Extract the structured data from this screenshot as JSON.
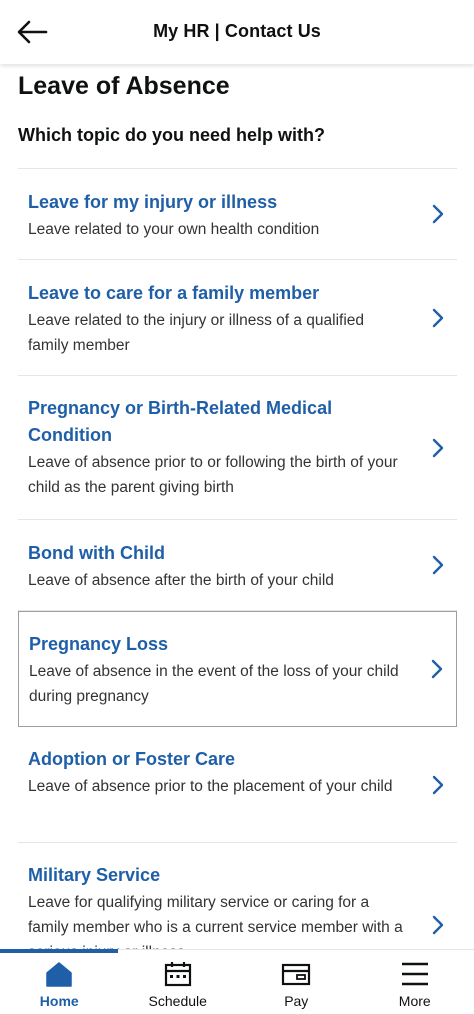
{
  "header": {
    "title": "My HR | Contact Us"
  },
  "page": {
    "title": "Leave of Absence",
    "question": "Which topic do you need help with?"
  },
  "topics": [
    {
      "title": "Leave for my injury or illness",
      "description": "Leave related to your own health condition"
    },
    {
      "title": "Leave to care for a family member",
      "description": "Leave related to the injury or illness of a qualified family member"
    },
    {
      "title": "Pregnancy or Birth-Related Medical Condition",
      "description": "Leave of absence prior to or following the birth of your child as the parent giving birth"
    },
    {
      "title": "Bond with Child",
      "description": "Leave of absence after the birth of your child"
    },
    {
      "title": "Pregnancy Loss",
      "description": "Leave of absence in the event of the loss of your child during pregnancy"
    },
    {
      "title": "Adoption or Foster Care",
      "description": "Leave of absence prior to the placement of your child"
    },
    {
      "title": "Military Service",
      "description": "Leave for qualifying military service or caring for a family member who is a current service member with a serious injury or illness"
    }
  ],
  "nav": {
    "items": [
      {
        "label": "Home",
        "icon": "home-icon",
        "active": true
      },
      {
        "label": "Schedule",
        "icon": "calendar-icon",
        "active": false
      },
      {
        "label": "Pay",
        "icon": "wallet-icon",
        "active": false
      },
      {
        "label": "More",
        "icon": "menu-icon",
        "active": false
      }
    ]
  },
  "colors": {
    "link": "#1f5fa8",
    "text": "#0f1111",
    "divider": "#e3e6e6"
  }
}
